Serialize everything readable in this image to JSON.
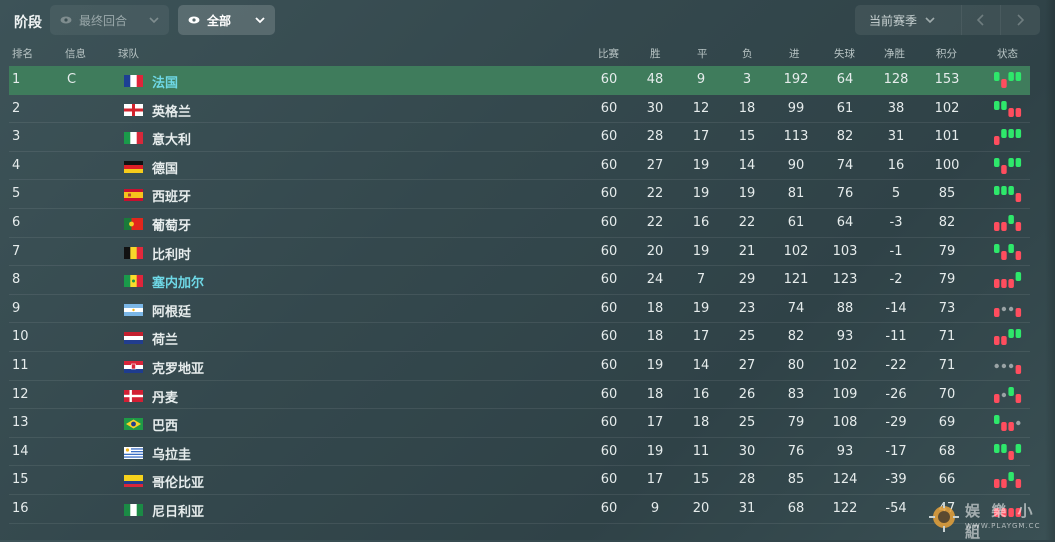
{
  "toolbar": {
    "stage_label": "阶段",
    "round_label": "最终回合",
    "filter_label": "全部",
    "season_label": "当前赛季"
  },
  "columns": {
    "rank": "排名",
    "info": "信息",
    "team": "球队",
    "played": "比赛",
    "won": "胜",
    "drawn": "平",
    "lost": "负",
    "gf": "进",
    "ga": "失球",
    "gd": "净胜",
    "pts": "积分",
    "form": "状态"
  },
  "colors": {
    "highlight_row": "#3f7c5c",
    "team_link": "#6ed8e6",
    "win": "#2ee86b",
    "loss": "#ff4d5e",
    "draw": "#9aa3a5"
  },
  "rows": [
    {
      "rank": "1",
      "info": "C",
      "team": "法国",
      "flag": "france",
      "link": true,
      "p": "60",
      "w": "48",
      "d": "9",
      "l": "3",
      "gf": "192",
      "ga": "64",
      "gd": "128",
      "pts": "153",
      "form": [
        "W",
        "L",
        "W",
        "W"
      ]
    },
    {
      "rank": "2",
      "info": "",
      "team": "英格兰",
      "flag": "england",
      "link": false,
      "p": "60",
      "w": "30",
      "d": "12",
      "l": "18",
      "gf": "99",
      "ga": "61",
      "gd": "38",
      "pts": "102",
      "form": [
        "W",
        "W",
        "L",
        "L"
      ]
    },
    {
      "rank": "3",
      "info": "",
      "team": "意大利",
      "flag": "italy",
      "link": false,
      "p": "60",
      "w": "28",
      "d": "17",
      "l": "15",
      "gf": "113",
      "ga": "82",
      "gd": "31",
      "pts": "101",
      "form": [
        "L",
        "W",
        "W",
        "W"
      ]
    },
    {
      "rank": "4",
      "info": "",
      "team": "德国",
      "flag": "germany",
      "link": false,
      "p": "60",
      "w": "27",
      "d": "19",
      "l": "14",
      "gf": "90",
      "ga": "74",
      "gd": "16",
      "pts": "100",
      "form": [
        "W",
        "L",
        "W",
        "W"
      ]
    },
    {
      "rank": "5",
      "info": "",
      "team": "西班牙",
      "flag": "spain",
      "link": false,
      "p": "60",
      "w": "22",
      "d": "19",
      "l": "19",
      "gf": "81",
      "ga": "76",
      "gd": "5",
      "pts": "85",
      "form": [
        "W",
        "W",
        "W",
        "L"
      ]
    },
    {
      "rank": "6",
      "info": "",
      "team": "葡萄牙",
      "flag": "portugal",
      "link": false,
      "p": "60",
      "w": "22",
      "d": "16",
      "l": "22",
      "gf": "61",
      "ga": "64",
      "gd": "-3",
      "pts": "82",
      "form": [
        "L",
        "L",
        "W",
        "L"
      ]
    },
    {
      "rank": "7",
      "info": "",
      "team": "比利时",
      "flag": "belgium",
      "link": false,
      "p": "60",
      "w": "20",
      "d": "19",
      "l": "21",
      "gf": "102",
      "ga": "103",
      "gd": "-1",
      "pts": "79",
      "form": [
        "W",
        "L",
        "W",
        "L"
      ]
    },
    {
      "rank": "8",
      "info": "",
      "team": "塞内加尔",
      "flag": "senegal",
      "link": true,
      "p": "60",
      "w": "24",
      "d": "7",
      "l": "29",
      "gf": "121",
      "ga": "123",
      "gd": "-2",
      "pts": "79",
      "form": [
        "L",
        "L",
        "L",
        "W"
      ]
    },
    {
      "rank": "9",
      "info": "",
      "team": "阿根廷",
      "flag": "argentina",
      "link": false,
      "p": "60",
      "w": "18",
      "d": "19",
      "l": "23",
      "gf": "74",
      "ga": "88",
      "gd": "-14",
      "pts": "73",
      "form": [
        "L",
        "D",
        "D",
        "L"
      ]
    },
    {
      "rank": "10",
      "info": "",
      "team": "荷兰",
      "flag": "netherlands",
      "link": false,
      "p": "60",
      "w": "18",
      "d": "17",
      "l": "25",
      "gf": "82",
      "ga": "93",
      "gd": "-11",
      "pts": "71",
      "form": [
        "L",
        "L",
        "W",
        "W"
      ]
    },
    {
      "rank": "11",
      "info": "",
      "team": "克罗地亚",
      "flag": "croatia",
      "link": false,
      "p": "60",
      "w": "19",
      "d": "14",
      "l": "27",
      "gf": "80",
      "ga": "102",
      "gd": "-22",
      "pts": "71",
      "form": [
        "D",
        "D",
        "D",
        "L"
      ]
    },
    {
      "rank": "12",
      "info": "",
      "team": "丹麦",
      "flag": "denmark",
      "link": false,
      "p": "60",
      "w": "18",
      "d": "16",
      "l": "26",
      "gf": "83",
      "ga": "109",
      "gd": "-26",
      "pts": "70",
      "form": [
        "L",
        "D",
        "W",
        "L"
      ]
    },
    {
      "rank": "13",
      "info": "",
      "team": "巴西",
      "flag": "brazil",
      "link": false,
      "p": "60",
      "w": "17",
      "d": "18",
      "l": "25",
      "gf": "79",
      "ga": "108",
      "gd": "-29",
      "pts": "69",
      "form": [
        "W",
        "L",
        "L",
        "D"
      ]
    },
    {
      "rank": "14",
      "info": "",
      "team": "乌拉圭",
      "flag": "uruguay",
      "link": false,
      "p": "60",
      "w": "19",
      "d": "11",
      "l": "30",
      "gf": "76",
      "ga": "93",
      "gd": "-17",
      "pts": "68",
      "form": [
        "W",
        "W",
        "L",
        "W"
      ]
    },
    {
      "rank": "15",
      "info": "",
      "team": "哥伦比亚",
      "flag": "colombia",
      "link": false,
      "p": "60",
      "w": "17",
      "d": "15",
      "l": "28",
      "gf": "85",
      "ga": "124",
      "gd": "-39",
      "pts": "66",
      "form": [
        "L",
        "L",
        "W",
        "L"
      ]
    },
    {
      "rank": "16",
      "info": "",
      "team": "尼日利亚",
      "flag": "nigeria",
      "link": false,
      "p": "60",
      "w": "9",
      "d": "20",
      "l": "31",
      "gf": "68",
      "ga": "122",
      "gd": "-54",
      "pts": "47",
      "form": [
        "L",
        "L",
        "L",
        "L"
      ]
    }
  ],
  "watermark": {
    "text": "娱 樂 小 組",
    "url": "WWW.PLAYGM.CC"
  }
}
